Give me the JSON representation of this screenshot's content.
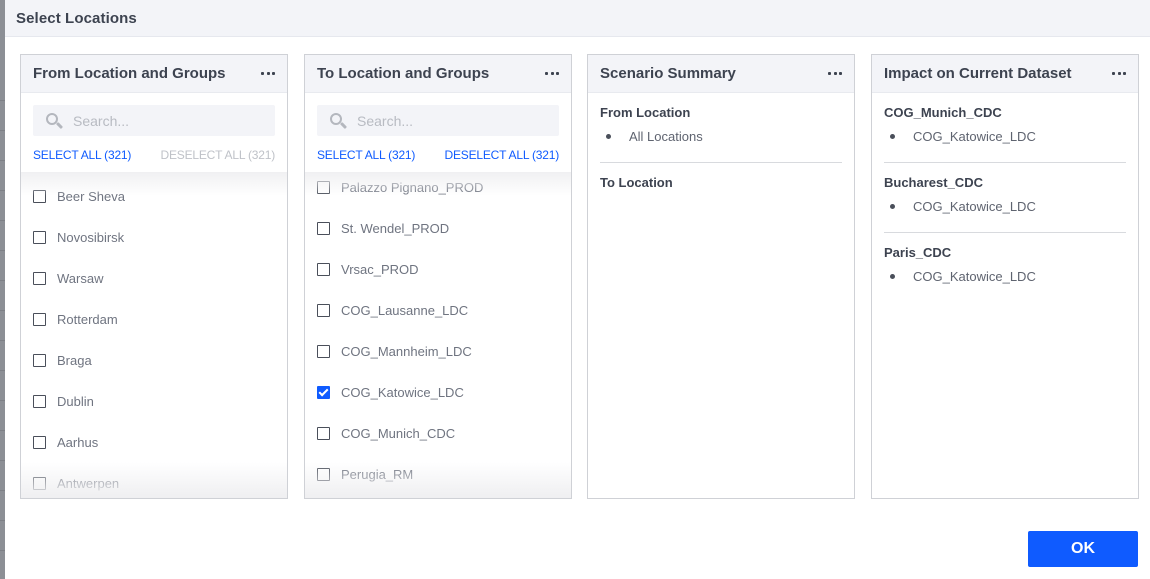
{
  "dialog": {
    "title": "Select Locations",
    "ok_label": "OK"
  },
  "from_panel": {
    "title": "From Location and Groups",
    "search_placeholder": "Search...",
    "select_all": "SELECT ALL (321)",
    "deselect_all": "DESELECT ALL (321)",
    "select_all_enabled": true,
    "deselect_all_enabled": false,
    "items": [
      {
        "label": "Beer Sheva",
        "checked": false
      },
      {
        "label": "Novosibirsk",
        "checked": false
      },
      {
        "label": "Warsaw",
        "checked": false
      },
      {
        "label": "Rotterdam",
        "checked": false
      },
      {
        "label": "Braga",
        "checked": false
      },
      {
        "label": "Dublin",
        "checked": false
      },
      {
        "label": "Aarhus",
        "checked": false
      },
      {
        "label": "Antwerpen",
        "checked": false
      }
    ]
  },
  "to_panel": {
    "title": "To Location and Groups",
    "search_placeholder": "Search...",
    "select_all": "SELECT ALL (321)",
    "deselect_all": "DESELECT ALL (321)",
    "select_all_enabled": true,
    "deselect_all_enabled": true,
    "items": [
      {
        "label": "Palazzo Pignano_PROD",
        "checked": false
      },
      {
        "label": "St. Wendel_PROD",
        "checked": false
      },
      {
        "label": "Vrsac_PROD",
        "checked": false
      },
      {
        "label": "COG_Lausanne_LDC",
        "checked": false
      },
      {
        "label": "COG_Mannheim_LDC",
        "checked": false
      },
      {
        "label": "COG_Katowice_LDC",
        "checked": true
      },
      {
        "label": "COG_Munich_CDC",
        "checked": false
      },
      {
        "label": "Perugia_RM",
        "checked": false
      }
    ]
  },
  "summary_panel": {
    "title": "Scenario Summary",
    "sections": [
      {
        "heading": "From Location",
        "items": [
          "All Locations"
        ]
      },
      {
        "heading": "To Location",
        "items": []
      }
    ]
  },
  "impact_panel": {
    "title": "Impact on Current Dataset",
    "sections": [
      {
        "heading": "COG_Munich_CDC",
        "items": [
          "COG_Katowice_LDC"
        ]
      },
      {
        "heading": "Bucharest_CDC",
        "items": [
          "COG_Katowice_LDC"
        ]
      },
      {
        "heading": "Paris_CDC",
        "items": [
          "COG_Katowice_LDC"
        ]
      }
    ]
  },
  "colors": {
    "accent": "#0f5bff",
    "disabled_text": "#bfc2c8",
    "header_bg": "#f3f4f8"
  }
}
